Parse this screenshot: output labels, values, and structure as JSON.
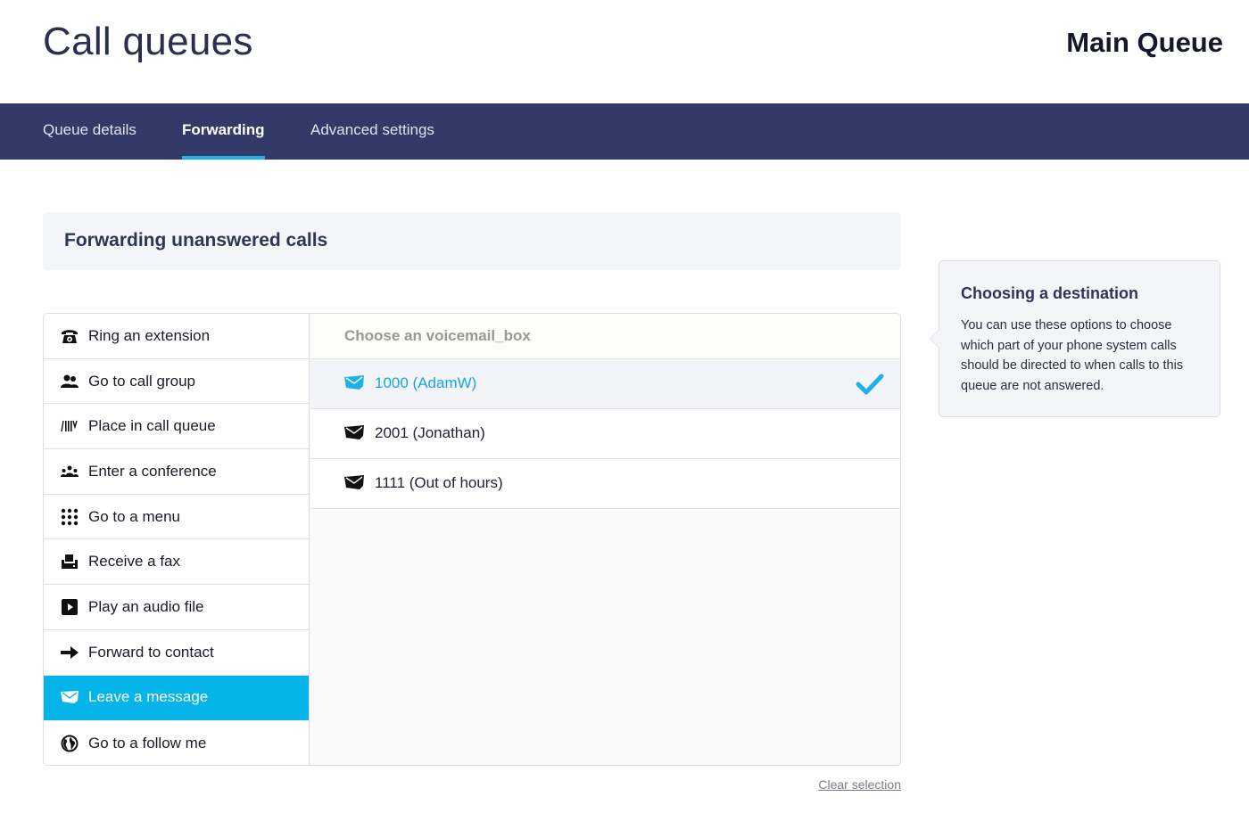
{
  "header": {
    "title": "Call queues",
    "queue_name": "Main Queue"
  },
  "tabs": [
    {
      "label": "Queue details",
      "active": false
    },
    {
      "label": "Forwarding",
      "active": true
    },
    {
      "label": "Advanced settings",
      "active": false
    }
  ],
  "section": {
    "title": "Forwarding unanswered calls"
  },
  "options": [
    {
      "label": "Ring an extension",
      "icon": "telephone-icon",
      "selected": false
    },
    {
      "label": "Go to call group",
      "icon": "users-icon",
      "selected": false
    },
    {
      "label": "Place in call queue",
      "icon": "queue-icon",
      "selected": false
    },
    {
      "label": "Enter a conference",
      "icon": "conference-icon",
      "selected": false
    },
    {
      "label": "Go to a menu",
      "icon": "keypad-icon",
      "selected": false
    },
    {
      "label": "Receive a fax",
      "icon": "fax-icon",
      "selected": false
    },
    {
      "label": "Play an audio file",
      "icon": "play-icon",
      "selected": false
    },
    {
      "label": "Forward to contact",
      "icon": "arrow-right-icon",
      "selected": false
    },
    {
      "label": "Leave a message",
      "icon": "voicemail-icon",
      "selected": true
    },
    {
      "label": "Go to a follow me",
      "icon": "globe-icon",
      "selected": false
    }
  ],
  "choices": {
    "heading": "Choose an voicemail_box",
    "items": [
      {
        "label": "1000 (AdamW)",
        "icon": "voicemail-icon",
        "selected": true
      },
      {
        "label": "2001 (Jonathan)",
        "icon": "voicemail-icon",
        "selected": false
      },
      {
        "label": "1111 (Out of hours)",
        "icon": "voicemail-icon",
        "selected": false
      }
    ]
  },
  "clear_selection": "Clear selection",
  "help": {
    "title": "Choosing a destination",
    "body": "You can use these options to choose which part of your phone system calls should be directed to when calls to this queue are not answered."
  },
  "colors": {
    "navbar": "#333a67",
    "accent": "#05b4e8",
    "selected_text": "#16a6dc"
  }
}
